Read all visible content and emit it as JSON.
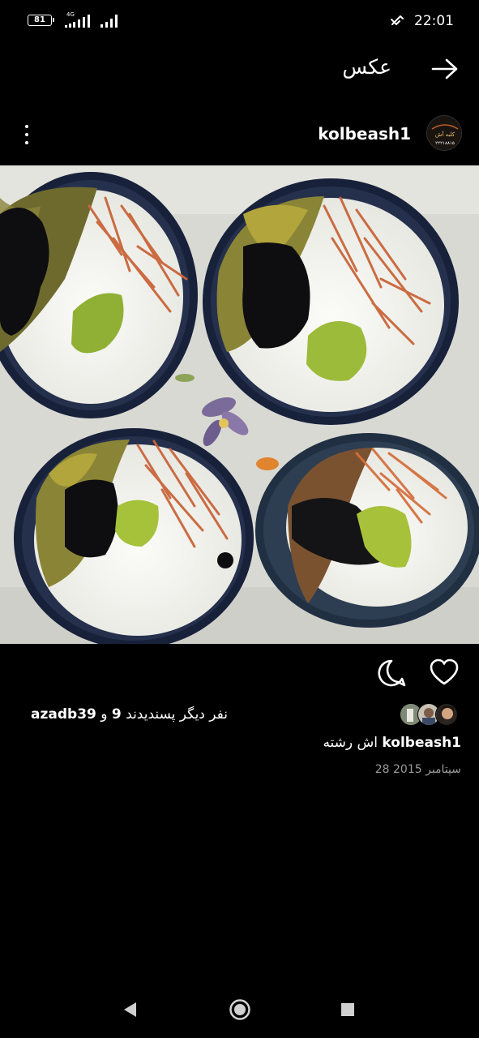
{
  "status_bar": {
    "battery": "81",
    "network": "4G",
    "time": "22:01"
  },
  "top_bar": {
    "title": "عکس",
    "back_icon": "arrow-right-icon"
  },
  "post": {
    "username": "kolbeash1",
    "avatar_text_line1": "کلبه آش",
    "avatar_text_line2": "۲۲۲۱۸۸۱۵",
    "more_icon": "kebab-menu-icon",
    "photo_description": "",
    "likes": {
      "prefix": "و",
      "count": "9",
      "suffix": "نفر دیگر پسندیدند",
      "user": "azadb39"
    },
    "caption": {
      "user": "kolbeash1",
      "text": "اش رشته"
    },
    "date": "28 سپتامبر 2015"
  },
  "colors": {
    "background": "#000000",
    "text": "#ffffff",
    "muted": "#9a9a9a"
  }
}
